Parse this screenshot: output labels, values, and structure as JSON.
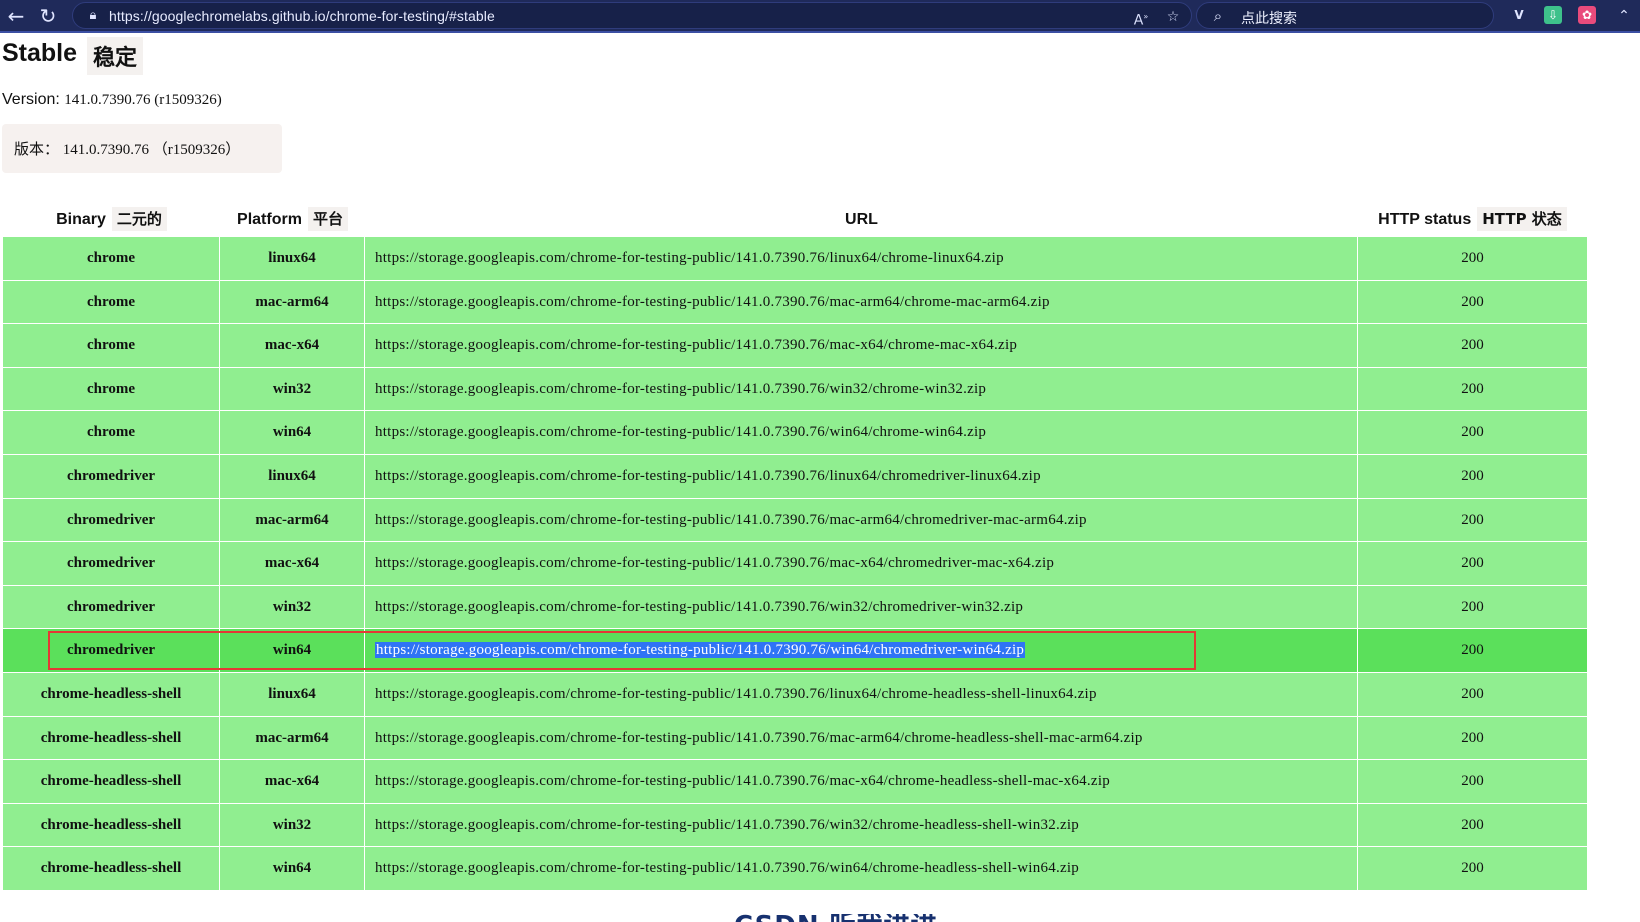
{
  "browser": {
    "url": "https://googlechromelabs.github.io/chrome-for-testing/#stable",
    "search_placeholder": "点此搜索",
    "read_aloud_label": "A",
    "icons": [
      "back-icon",
      "reload-icon",
      "lock-icon",
      "read-aloud-icon",
      "favorite-star-icon",
      "search-icon",
      "vpn-extension-icon",
      "download-extension-icon",
      "app-extension-icon"
    ]
  },
  "page": {
    "title": "Stable",
    "title_cn": "稳定",
    "version_label": "Version:",
    "version_value": "141.0.7390.76 (r1509326)",
    "version_cn": "版本： 141.0.7390.76 （r1509326）"
  },
  "table": {
    "headers": {
      "binary": "Binary",
      "binary_cn": "二元的",
      "platform": "Platform",
      "platform_cn": "平台",
      "url": "URL",
      "http_status": "HTTP status",
      "http_status_cn": "HTTP 状态"
    },
    "rows": [
      {
        "binary": "chrome",
        "platform": "linux64",
        "url": "https://storage.googleapis.com/chrome-for-testing-public/141.0.7390.76/linux64/chrome-linux64.zip",
        "status": "200"
      },
      {
        "binary": "chrome",
        "platform": "mac-arm64",
        "url": "https://storage.googleapis.com/chrome-for-testing-public/141.0.7390.76/mac-arm64/chrome-mac-arm64.zip",
        "status": "200"
      },
      {
        "binary": "chrome",
        "platform": "mac-x64",
        "url": "https://storage.googleapis.com/chrome-for-testing-public/141.0.7390.76/mac-x64/chrome-mac-x64.zip",
        "status": "200"
      },
      {
        "binary": "chrome",
        "platform": "win32",
        "url": "https://storage.googleapis.com/chrome-for-testing-public/141.0.7390.76/win32/chrome-win32.zip",
        "status": "200"
      },
      {
        "binary": "chrome",
        "platform": "win64",
        "url": "https://storage.googleapis.com/chrome-for-testing-public/141.0.7390.76/win64/chrome-win64.zip",
        "status": "200"
      },
      {
        "binary": "chromedriver",
        "platform": "linux64",
        "url": "https://storage.googleapis.com/chrome-for-testing-public/141.0.7390.76/linux64/chromedriver-linux64.zip",
        "status": "200"
      },
      {
        "binary": "chromedriver",
        "platform": "mac-arm64",
        "url": "https://storage.googleapis.com/chrome-for-testing-public/141.0.7390.76/mac-arm64/chromedriver-mac-arm64.zip",
        "status": "200"
      },
      {
        "binary": "chromedriver",
        "platform": "mac-x64",
        "url": "https://storage.googleapis.com/chrome-for-testing-public/141.0.7390.76/mac-x64/chromedriver-mac-x64.zip",
        "status": "200"
      },
      {
        "binary": "chromedriver",
        "platform": "win32",
        "url": "https://storage.googleapis.com/chrome-for-testing-public/141.0.7390.76/win32/chromedriver-win32.zip",
        "status": "200"
      },
      {
        "binary": "chromedriver",
        "platform": "win64",
        "url": "https://storage.googleapis.com/chrome-for-testing-public/141.0.7390.76/win64/chromedriver-win64.zip",
        "status": "200",
        "highlighted": true
      },
      {
        "binary": "chrome-headless-shell",
        "platform": "linux64",
        "url": "https://storage.googleapis.com/chrome-for-testing-public/141.0.7390.76/linux64/chrome-headless-shell-linux64.zip",
        "status": "200"
      },
      {
        "binary": "chrome-headless-shell",
        "platform": "mac-arm64",
        "url": "https://storage.googleapis.com/chrome-for-testing-public/141.0.7390.76/mac-arm64/chrome-headless-shell-mac-arm64.zip",
        "status": "200"
      },
      {
        "binary": "chrome-headless-shell",
        "platform": "mac-x64",
        "url": "https://storage.googleapis.com/chrome-for-testing-public/141.0.7390.76/mac-x64/chrome-headless-shell-mac-x64.zip",
        "status": "200"
      },
      {
        "binary": "chrome-headless-shell",
        "platform": "win32",
        "url": "https://storage.googleapis.com/chrome-for-testing-public/141.0.7390.76/win32/chrome-headless-shell-win32.zip",
        "status": "200"
      },
      {
        "binary": "chrome-headless-shell",
        "platform": "win64",
        "url": "https://storage.googleapis.com/chrome-for-testing-public/141.0.7390.76/win64/chrome-headless-shell-win64.zip",
        "status": "200"
      }
    ]
  },
  "watermark": "CSDN 听我讲讲",
  "colors": {
    "browser_bar": "#1f2a5a",
    "row_green": "#90ee90",
    "row_highlight": "#5be05b",
    "selection_blue": "#2f74f5",
    "annotation_red": "#e53935"
  }
}
